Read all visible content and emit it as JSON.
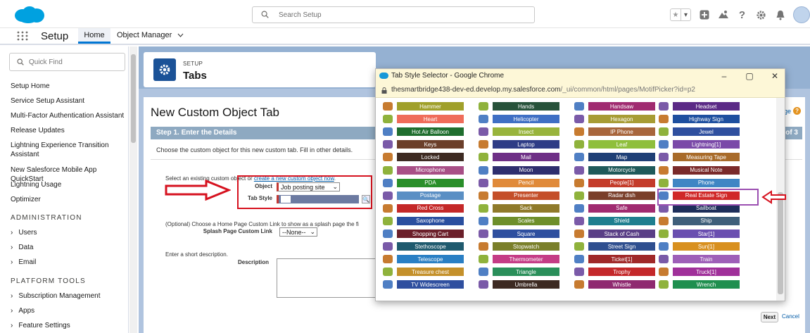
{
  "header": {
    "search_placeholder": "Search Setup",
    "help_glyph": "?"
  },
  "nav": {
    "app_name": "Setup",
    "tabs": [
      {
        "label": "Home"
      },
      {
        "label": "Object Manager"
      }
    ]
  },
  "sidebar": {
    "quick_find_placeholder": "Quick Find",
    "items": [
      {
        "label": "Setup Home"
      },
      {
        "label": "Service Setup Assistant"
      },
      {
        "label": "Multi-Factor Authentication Assistant"
      },
      {
        "label": "Release Updates"
      },
      {
        "label": "Lightning Experience Transition Assistant"
      },
      {
        "label": "New Salesforce Mobile App QuickStart"
      },
      {
        "label": "Lightning Usage"
      },
      {
        "label": "Optimizer"
      }
    ],
    "sections": [
      {
        "heading": "ADMINISTRATION",
        "items": [
          {
            "label": "Users"
          },
          {
            "label": "Data"
          },
          {
            "label": "Email"
          }
        ]
      },
      {
        "heading": "PLATFORM TOOLS",
        "items": [
          {
            "label": "Subscription Management"
          },
          {
            "label": "Apps"
          },
          {
            "label": "Feature Settings"
          }
        ]
      }
    ]
  },
  "setup_header": {
    "label": "SETUP",
    "title": "Tabs"
  },
  "page": {
    "heading": "New Custom Object Tab",
    "help_text": "ge",
    "step_title": "Step 1. Enter the Details",
    "step_count": "of 3",
    "intro": "Choose the custom object for this new custom tab. Fill in other details.",
    "select_prefix": "Select an existing custom object or",
    "select_link": "create a new custom object now",
    "select_suffix": ".",
    "object_label": "Object",
    "object_value": "Job posting site",
    "tab_style_label": "Tab Style",
    "optional_text": "(Optional) Choose a Home Page Custom Link to show as a splash page the fi",
    "splash_label": "Splash Page Custom Link",
    "splash_value": "--None--",
    "short_desc": "Enter a short description.",
    "description_label": "Description",
    "next_label": "Next",
    "cancel_label": "Cancel"
  },
  "popup": {
    "title": "Tab Style Selector - Google Chrome",
    "url_host": "thesmartbridge438-dev-ed.develop.my.salesforce.com",
    "url_path": "/_ui/common/html/pages/MotifPicker?id=p2",
    "rows": [
      [
        "Hammer",
        "Hands",
        "Handsaw",
        "Headset"
      ],
      [
        "Heart",
        "Helicopter",
        "Hexagon",
        "Highway Sign"
      ],
      [
        "Hot Air Balloon",
        "Insect",
        "IP Phone",
        "Jewel"
      ],
      [
        "Keys",
        "Laptop",
        "Leaf",
        "Lightning[1]"
      ],
      [
        "Locked",
        "Mail",
        "Map",
        "Measuring Tape"
      ],
      [
        "Microphone",
        "Moon",
        "Motorcycle",
        "Musical Note"
      ],
      [
        "PDA",
        "Pencil",
        "People[1]",
        "Phone"
      ],
      [
        "Postage",
        "Presenter",
        "Radar dish",
        "Real Estate Sign"
      ],
      [
        "Red Cross",
        "Sack",
        "Safe",
        "Sailboat"
      ],
      [
        "Saxophone",
        "Scales",
        "Shield",
        "Ship"
      ],
      [
        "Shopping Cart",
        "Square",
        "Stack of Cash",
        "Star[1]"
      ],
      [
        "Stethoscope",
        "Stopwatch",
        "Street Sign",
        "Sun[1]"
      ],
      [
        "Telescope",
        "Thermometer",
        "Ticket[1]",
        "Train"
      ],
      [
        "Treasure chest",
        "Triangle",
        "Trophy",
        "Truck[1]"
      ],
      [
        "TV Widescreen",
        "Umbrella",
        "Whistle",
        "Wrench"
      ]
    ],
    "colors": [
      [
        "#a0a02a",
        "#27523a",
        "#a02b70",
        "#5b2a86"
      ],
      [
        "#ef6c5a",
        "#3f6fc4",
        "#a79c34",
        "#1e4f9f"
      ],
      [
        "#1f6e2e",
        "#98b43c",
        "#a8663c",
        "#2f4f9f"
      ],
      [
        "#6b3f2a",
        "#2e3c86",
        "#8fbf3c",
        "#7a49a8"
      ],
      [
        "#3d2a22",
        "#6e2f86",
        "#1e3f76",
        "#a86b2a"
      ],
      [
        "#a84f86",
        "#2e2e6e",
        "#1f5a5a",
        "#7a2a2a"
      ],
      [
        "#2a8f2a",
        "#e08a3a",
        "#c43c2a",
        "#3f86c4"
      ],
      [
        "#5a8fc4",
        "#c44f2a",
        "#7a3f2a",
        "#d02828"
      ],
      [
        "#c42828",
        "#8f7a2a",
        "#a02b70",
        "#1e2e5a"
      ],
      [
        "#2a4f9f",
        "#6e8f2a",
        "#1f7f8f",
        "#3f5f7a"
      ],
      [
        "#6b1f2a",
        "#2e4f9f",
        "#5a3f86",
        "#6a4fb0"
      ],
      [
        "#1f5a6e",
        "#7a7f2a",
        "#2f4f8f",
        "#d8901f"
      ],
      [
        "#2a7fc4",
        "#c43c86",
        "#a02828",
        "#9e5fb8"
      ],
      [
        "#c4902a",
        "#2a8f5a",
        "#c4282a",
        "#a0309a"
      ],
      [
        "#2f4f9f",
        "#3d2a22",
        "#8f2a70",
        "#1f8f4f"
      ]
    ],
    "icon_colors": [
      "#c77b30",
      "#8fb23c",
      "#4f7fc4",
      "#7a5aa8"
    ]
  }
}
